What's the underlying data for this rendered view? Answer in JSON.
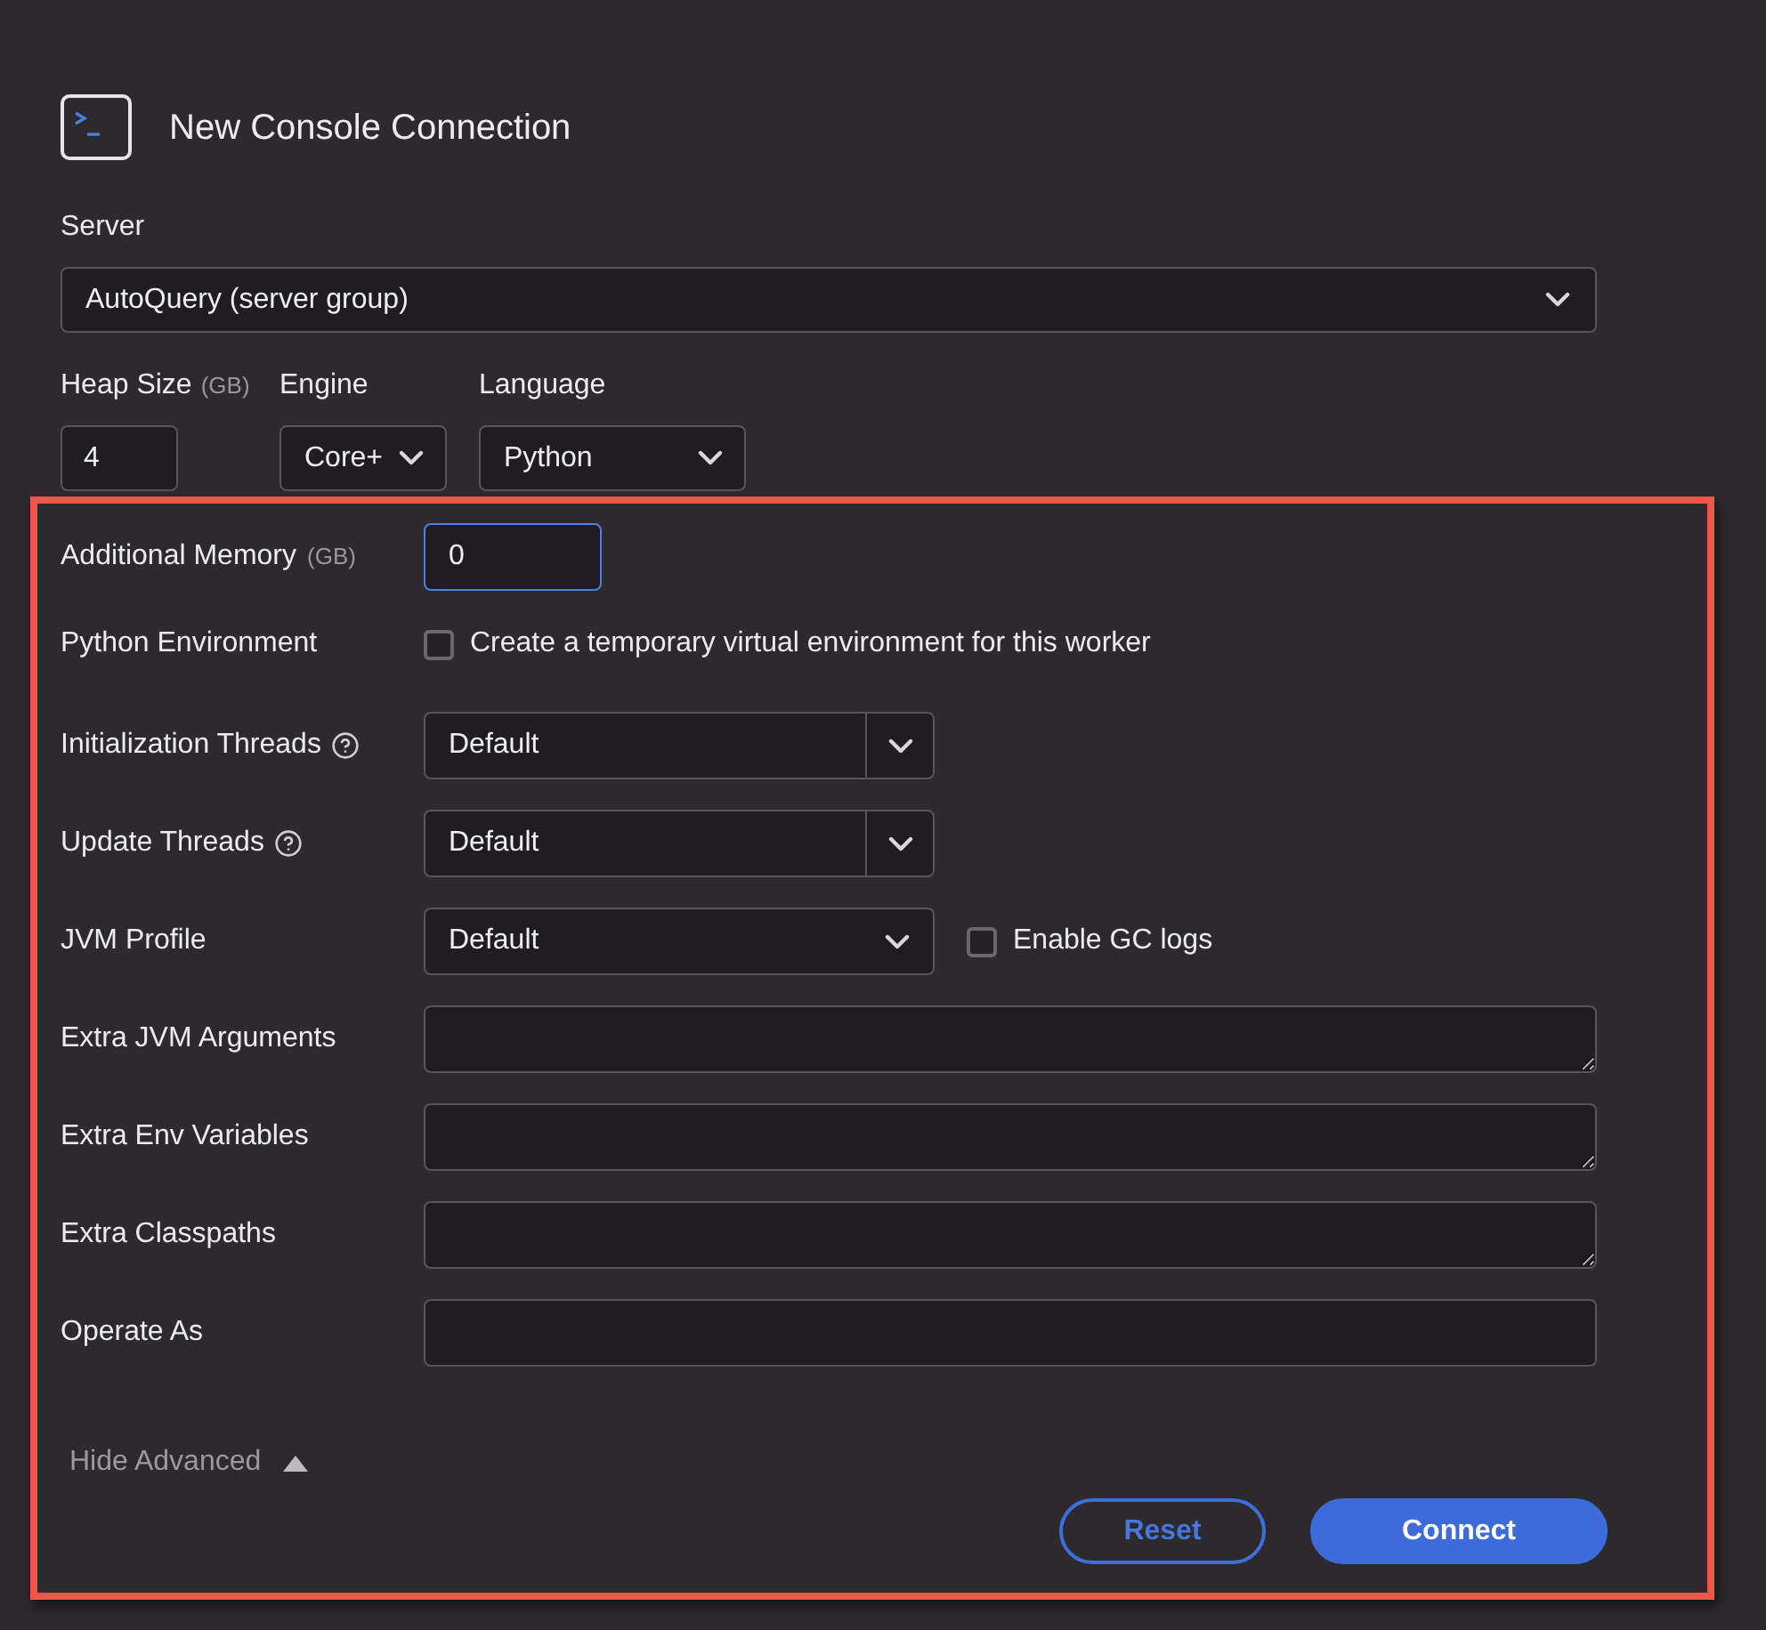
{
  "header": {
    "title": "New Console Connection"
  },
  "server": {
    "label": "Server",
    "value": "AutoQuery (server group)"
  },
  "basic_fields": [
    {
      "kind": "input",
      "label": "Heap Size",
      "unit": "(GB)",
      "value": "4"
    },
    {
      "kind": "select",
      "label": "Engine",
      "value": "Core+"
    },
    {
      "kind": "select",
      "label": "Language",
      "value": "Python"
    }
  ],
  "advanced_fields": [
    {
      "kind": "number",
      "label": "Additional Memory",
      "unit": "(GB)",
      "value": "0",
      "focused": true
    },
    {
      "kind": "checkbox",
      "label": "Python Environment",
      "option": "Create a temporary virtual environment for this worker",
      "checked": false
    },
    {
      "kind": "split_select",
      "label": "Initialization Threads",
      "value": "Default",
      "help": true
    },
    {
      "kind": "split_select",
      "label": "Update Threads",
      "value": "Default",
      "help": true
    },
    {
      "kind": "select_checkbox",
      "label": "JVM Profile",
      "value": "Default",
      "option": "Enable GC logs",
      "checked": false
    },
    {
      "kind": "textarea",
      "label": "Extra JVM Arguments",
      "focused": false
    },
    {
      "kind": "textarea",
      "label": "Extra Env Variables",
      "focused": false
    },
    {
      "kind": "textarea",
      "label": "Extra Classpaths",
      "focused": false
    },
    {
      "kind": "text",
      "label": "Operate As",
      "focused": false
    }
  ],
  "toggle": {
    "label": "Hide Advanced",
    "expanded": true
  },
  "buttons": [
    {
      "kind": "secondary",
      "label": "Reset"
    },
    {
      "kind": "primary",
      "label": "Connect"
    }
  ]
}
